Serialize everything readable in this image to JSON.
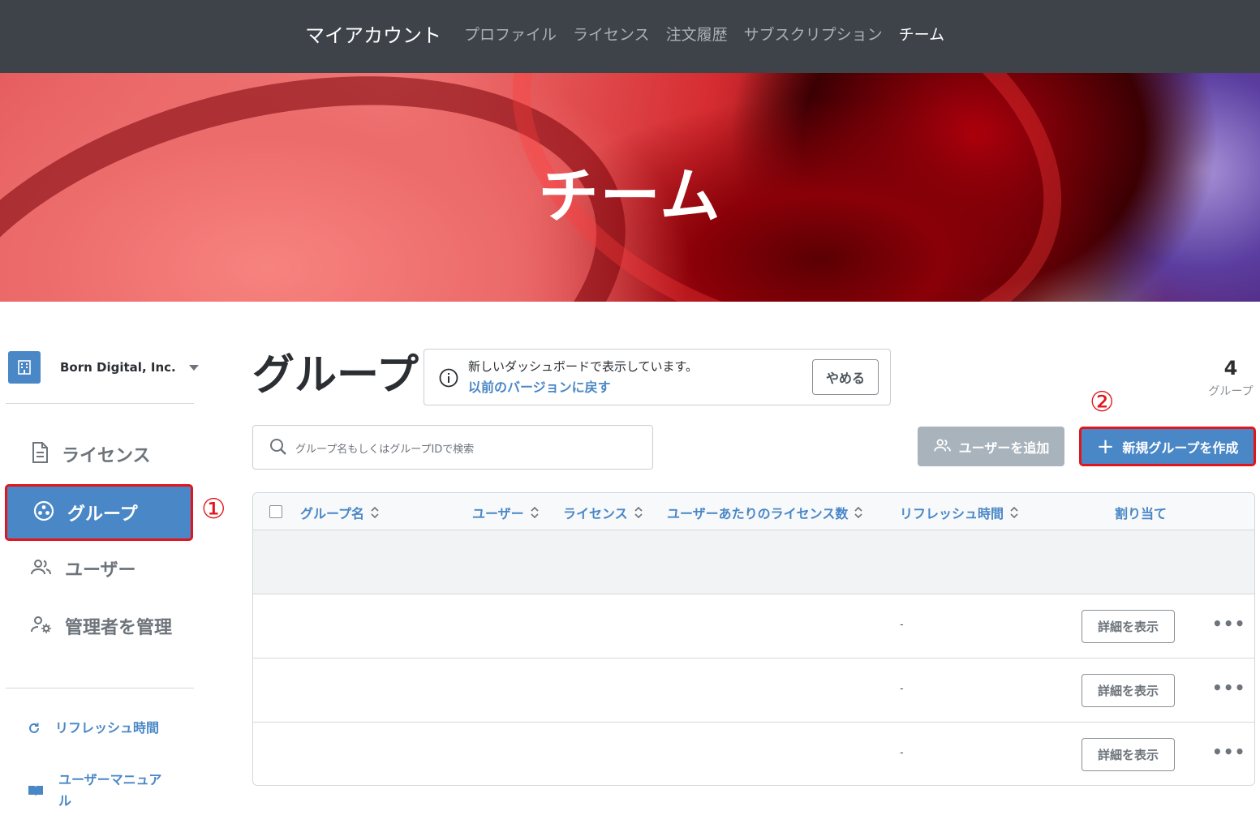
{
  "topnav": {
    "brand": "マイアカウント",
    "links": [
      {
        "label": "プロファイル"
      },
      {
        "label": "ライセンス"
      },
      {
        "label": "注文履歴"
      },
      {
        "label": "サブスクリプション"
      },
      {
        "label": "チーム"
      }
    ],
    "active_link": "チーム"
  },
  "hero": {
    "title": "チーム"
  },
  "sidebar": {
    "org_name": "Born Digital, Inc.",
    "org_icon": "building-icon",
    "items": [
      {
        "label": "ライセンス",
        "icon": "document-icon"
      },
      {
        "label": "グループ",
        "icon": "group-icon"
      },
      {
        "label": "ユーザー",
        "icon": "users-icon"
      },
      {
        "label": "管理者を管理",
        "icon": "admin-gear-icon"
      }
    ],
    "footer_links": [
      {
        "label": "リフレッシュ時間",
        "icon": "refresh-icon"
      },
      {
        "label": "ユーザーマニュアル",
        "icon": "book-icon"
      }
    ]
  },
  "annotations": {
    "callout_1": "①",
    "callout_2": "②"
  },
  "main": {
    "title": "グループ",
    "notice": {
      "text": "新しいダッシュボードで表示しています。",
      "link": "以前のバージョンに戻す",
      "dismiss": "やめる"
    },
    "count": {
      "value": "4",
      "label": "グループ"
    },
    "search": {
      "placeholder": "グループ名もしくはグループIDで検索"
    },
    "add_user_button": "ユーザーを追加",
    "create_group_button": "新規グループを作成",
    "table": {
      "columns": [
        "グループ名",
        "ユーザー",
        "ライセンス",
        "ユーザーあたりのライセンス数",
        "リフレッシュ時間",
        "割り当て"
      ],
      "rows": [
        {
          "refresh": "-",
          "action": "詳細を表示"
        },
        {
          "refresh": "-",
          "action": "詳細を表示"
        },
        {
          "refresh": "-",
          "action": "詳細を表示"
        }
      ]
    }
  },
  "colors": {
    "accent": "#4a87c6",
    "highlight": "#e2151b",
    "nav_bg": "#3d4349"
  }
}
